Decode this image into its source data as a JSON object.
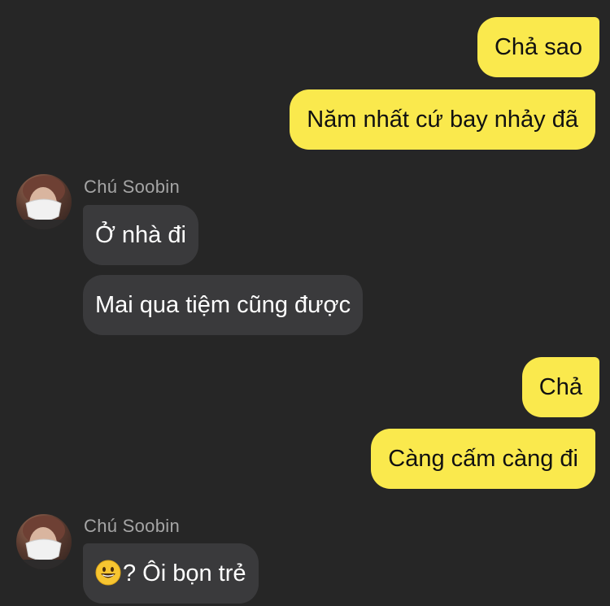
{
  "colors": {
    "background": "#262626",
    "outgoing_bubble": "#fae94d",
    "incoming_bubble": "#3a3a3c",
    "sender_name": "#a5a5a5"
  },
  "messages": {
    "out_1": "Chả sao",
    "out_2": "Năm nhất cứ bay nhảy đã",
    "group_1": {
      "sender": "Chú Soobin",
      "msg_1": "Ở nhà đi",
      "msg_2": "Mai qua tiệm cũng được"
    },
    "out_3": "Chả",
    "out_4": "Càng cấm càng đi",
    "group_2": {
      "sender": "Chú Soobin",
      "emoji": "grinning-face-emoji",
      "msg_1": "? Ôi bọn trẻ"
    }
  }
}
